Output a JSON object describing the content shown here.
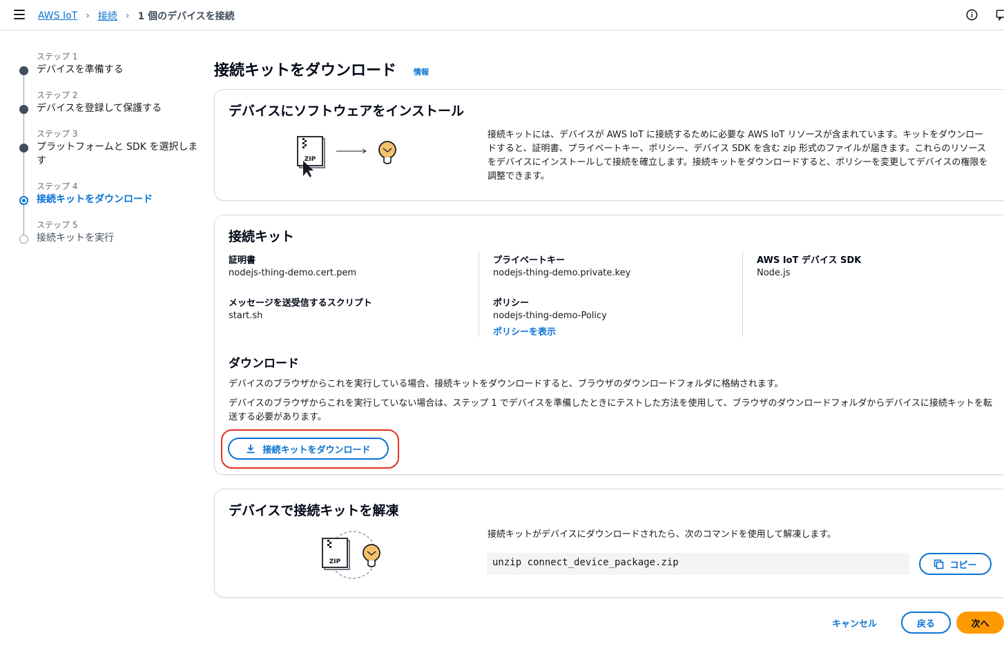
{
  "breadcrumb": {
    "root": "AWS IoT",
    "connect": "接続",
    "current": "1 個のデバイスを接続"
  },
  "steps": [
    {
      "num": "ステップ 1",
      "title": "デバイスを準備する",
      "state": "done"
    },
    {
      "num": "ステップ 2",
      "title": "デバイスを登録して保護する",
      "state": "done"
    },
    {
      "num": "ステップ 3",
      "title": "プラットフォームと SDK を選択します",
      "state": "done"
    },
    {
      "num": "ステップ 4",
      "title": "接続キットをダウンロード",
      "state": "active"
    },
    {
      "num": "ステップ 5",
      "title": "接続キットを実行",
      "state": "todo"
    }
  ],
  "page": {
    "title": "接続キットをダウンロード",
    "info": "情報"
  },
  "install_card": {
    "title": "デバイスにソフトウェアをインストール",
    "zip_label": "ZIP",
    "description": "接続キットには、デバイスが AWS IoT に接続するために必要な AWS IoT リソースが含まれています。キットをダウンロードすると、証明書、プライベートキー、ポリシー、デバイス SDK を含む zip 形式のファイルが届きます。これらのリソースをデバイスにインストールして接続を確立します。接続キットをダウンロードすると、ポリシーを変更してデバイスの権限を調整できます。"
  },
  "kit_card": {
    "title": "接続キット",
    "cert_label": "証明書",
    "cert_value": "nodejs-thing-demo.cert.pem",
    "script_label": "メッセージを送受信するスクリプト",
    "script_value": "start.sh",
    "key_label": "プライベートキー",
    "key_value": "nodejs-thing-demo.private.key",
    "policy_label": "ポリシー",
    "policy_value": "nodejs-thing-demo-Policy",
    "policy_link": "ポリシーを表示",
    "sdk_label": "AWS IoT デバイス SDK",
    "sdk_value": "Node.js",
    "download_title": "ダウンロード",
    "download_para1": "デバイスのブラウザからこれを実行している場合、接続キットをダウンロードすると、ブラウザのダウンロードフォルダに格納されます。",
    "download_para2": "デバイスのブラウザからこれを実行していない場合は、ステップ 1 でデバイスを準備したときにテストした方法を使用して、ブラウザのダウンロードフォルダからデバイスに接続キットを転送する必要があります。",
    "download_button": "接続キットをダウンロード"
  },
  "unzip_card": {
    "title": "デバイスで接続キットを解凍",
    "zip_label": "ZIP",
    "description": "接続キットがデバイスにダウンロードされたら、次のコマンドを使用して解凍します。",
    "command": "unzip connect_device_package.zip",
    "copy_button": "コピー"
  },
  "footer": {
    "cancel": "キャンセル",
    "back": "戻る",
    "next": "次へ"
  },
  "colors": {
    "accent": "#0972d3",
    "primary": "#ff9900",
    "highlight": "#e0301e"
  }
}
